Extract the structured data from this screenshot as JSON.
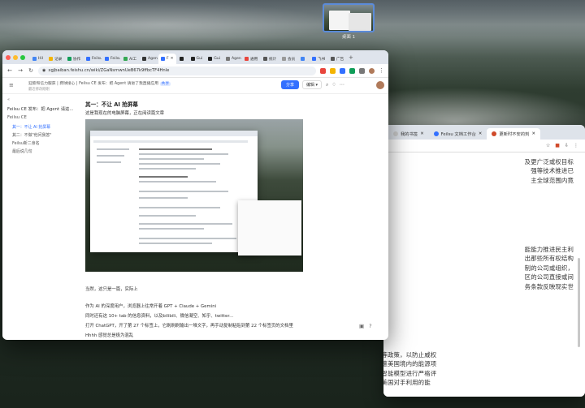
{
  "desktop": {
    "space_label": "桌面 1"
  },
  "main_window": {
    "tabs": [
      {
        "label": "Hil",
        "color": "#4285f4"
      },
      {
        "label": "记录",
        "color": "#f4b400"
      },
      {
        "label": "协作",
        "color": "#0f9d58"
      },
      {
        "label": "Feilsu",
        "color": "#3370ff"
      },
      {
        "label": "Feilsu",
        "color": "#3370ff"
      },
      {
        "label": "AI工",
        "color": "#34a853"
      },
      {
        "label": "Agen",
        "color": "#333333"
      },
      {
        "label": "F",
        "color": "#3370ff",
        "active": true
      },
      {
        "label": "",
        "color": "#222222"
      },
      {
        "label": "Gui",
        "color": "#222222"
      },
      {
        "label": "Gui",
        "color": "#222222"
      },
      {
        "label": "Agen",
        "color": "#777777"
      },
      {
        "label": "通用",
        "color": "#e8453c"
      },
      {
        "label": "统计",
        "color": "#555555"
      },
      {
        "label": "会员",
        "color": "#999999"
      },
      {
        "label": "",
        "color": "#4285f4"
      },
      {
        "label": "飞书",
        "color": "#3370ff"
      },
      {
        "label": "广告",
        "color": "#555555"
      }
    ],
    "url": "xgjbaiban.feishu.cn/wiki/ZGaNsrnwnUeB67k9ffbcTF4Hnle",
    "breadcrumbs": "迎索和信力服获 | 费球接心 | Feilsu CE 发布：把 Agent 请进了我直播应用",
    "badge": "共享",
    "subtitle": "最近修改刚刚",
    "share_label": "分享",
    "edit_label": "编辑",
    "sidebar": {
      "title": "Feilsu CE 发布：把 Agent 请进...",
      "section": "Feilsu CE",
      "items": [
        {
          "label": "其一：不让 AI 抢屏幕",
          "active": true
        },
        {
          "label": "其二：不做\"他问我答\"",
          "active": false
        },
        {
          "label": "Feilsu新二身名",
          "active": false
        },
        {
          "label": "最后说几句",
          "active": false
        }
      ]
    },
    "content": {
      "heading": "其一：不让 AI 抢屏幕",
      "intro": "这是我现在的电脑屏幕，正在阅读篇文章",
      "lines": [
        "当然，这只是一篇，实际上",
        "作为 AI 的深度用户，浏览器上往常开着 GPT + Claude + Gemini",
        "同时还有这 10+ tab 的信息资料，以及bilibili、微信凝空、知乎、twitter...",
        "打开 ChatGPT，开了第 27 个标签上，它刷刷刷输出一堆文字，再手动复制粘贴到第 22 个标签页的文档里",
        "Hhhh 感觉总是极为混乱"
      ]
    }
  },
  "right_window": {
    "tabs": [
      {
        "label": "我的书签"
      },
      {
        "label": "Feilsu 文档工作台"
      },
      {
        "label": "更新时不安的刻",
        "active": true
      }
    ],
    "paragraphs": [
      {
        "lines": [
          "及更广泛或权目标",
          "强等技术推进已",
          "主全球范围内竟"
        ]
      },
      {
        "lines": [
          "能能力推进民主利",
          "出那些所有权结构",
          "制的公司或组织，",
          "区的公司直接或间",
          "务条款反映现实世"
        ]
      }
    ],
    "bottom_text": [
      "与此关切一致，我们继续倡导实施强有力的出口管制等政策，以防止威权",
      "国家发展可能威胁国家安全的前沿人工智能能力，加速美国境内的能源项",
      "目以构建大规模的人工智能扩展基础设施，并对人工智能模型进行严格评",
      "估，评估其与国家安全相关的能力，包括那些可能被美国对手利用的能",
      "力。"
    ]
  }
}
